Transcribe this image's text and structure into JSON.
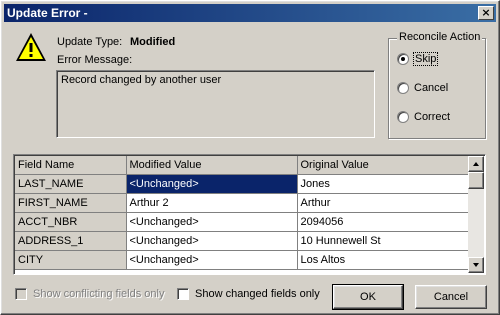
{
  "window": {
    "title": "Update Error -",
    "close_glyph": "×"
  },
  "info": {
    "update_type_label": "Update Type:",
    "update_type_value": "Modified",
    "error_message_label": "Error Message:",
    "error_message_value": "Record changed by another user",
    "icon": "warning-icon"
  },
  "reconcile": {
    "title": "Reconcile Action",
    "options": [
      {
        "label": "Skip",
        "selected": true
      },
      {
        "label": "Cancel",
        "selected": false
      },
      {
        "label": "Correct",
        "selected": false
      }
    ]
  },
  "grid": {
    "columns": [
      "Field Name",
      "Modified Value",
      "Original Value"
    ],
    "rows": [
      {
        "field": "LAST_NAME",
        "modified": "<Unchanged>",
        "original": "Jones",
        "selected": true
      },
      {
        "field": "FIRST_NAME",
        "modified": "Arthur 2",
        "original": "Arthur"
      },
      {
        "field": "ACCT_NBR",
        "modified": "<Unchanged>",
        "original": "2094056"
      },
      {
        "field": "ADDRESS_1",
        "modified": "<Unchanged>",
        "original": "10 Hunnewell St"
      },
      {
        "field": "CITY",
        "modified": "<Unchanged>",
        "original": "Los Altos"
      }
    ]
  },
  "options": {
    "show_conflicting": {
      "label": "Show conflicting fields only",
      "checked": false,
      "disabled": true
    },
    "show_changed": {
      "label": "Show changed fields only",
      "checked": false,
      "disabled": false
    }
  },
  "buttons": {
    "ok": "OK",
    "cancel": "Cancel"
  },
  "colors": {
    "titlebar": "#0a246a",
    "selection": "#0a246a",
    "face": "#d4d0c8"
  }
}
